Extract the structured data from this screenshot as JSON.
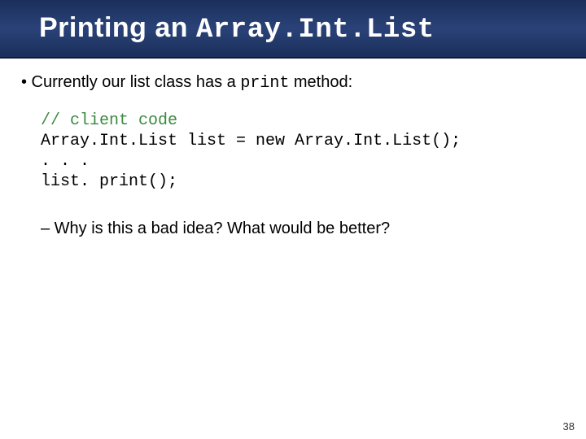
{
  "title": {
    "part1": "Printing an ",
    "part2_mono": "Array.Int.List"
  },
  "bullet": {
    "prefix": "• Currently our list class has a ",
    "mono": "print",
    "suffix": " method:"
  },
  "code": {
    "comment": "// client code",
    "line1": "Array.Int.List list = new Array.Int.List();",
    "line2": ". . .",
    "line3": "list. print();"
  },
  "sub_bullet": "– Why is this a bad idea?  What would be better?",
  "page_number": "38"
}
